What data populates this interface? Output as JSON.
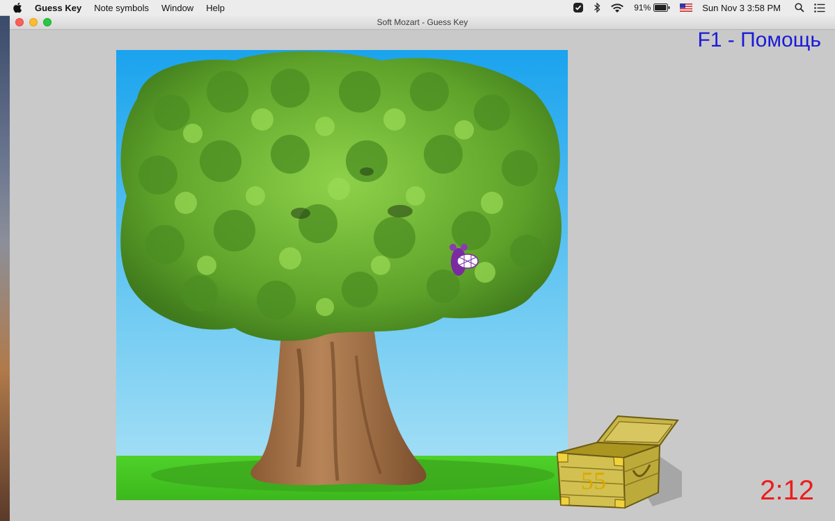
{
  "menubar": {
    "app_name": "Guess Key",
    "items": [
      "Note symbols",
      "Window",
      "Help"
    ],
    "battery": "91%",
    "clock": "Sun Nov 3  3:58 PM"
  },
  "window": {
    "title": "Soft Mozart - Guess Key"
  },
  "game": {
    "help_hint": "F1 - Помощь",
    "timer": "2:12",
    "score": "55"
  },
  "colors": {
    "help_text": "#1b1bd6",
    "timer_text": "#ee1c1c",
    "score_text": "#d8a800"
  }
}
